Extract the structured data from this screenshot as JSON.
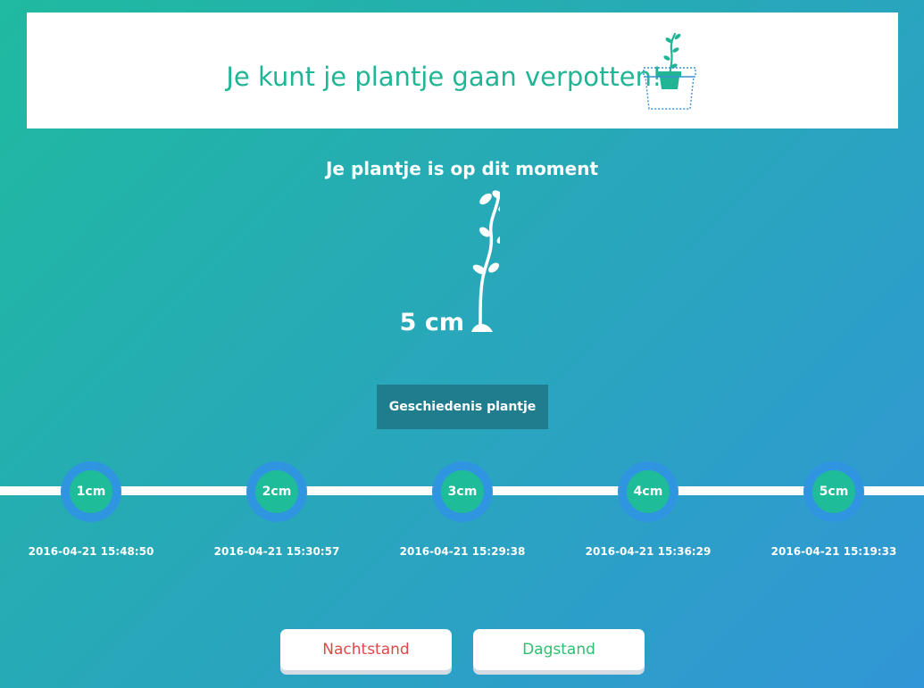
{
  "banner": {
    "message": "Je kunt je plantje gaan verpotten!",
    "icon": "potted-plant-icon",
    "accent_color": "#22b595"
  },
  "current": {
    "heading": "Je plantje is op dit moment",
    "size": "5 cm",
    "icon": "sprout-icon"
  },
  "history_button": {
    "label": "Geschiedenis plantje",
    "color": "#207d8d"
  },
  "timeline": [
    {
      "size": "1cm",
      "date": "2016-04-21 15:48:50"
    },
    {
      "size": "2cm",
      "date": "2016-04-21 15:30:57"
    },
    {
      "size": "3cm",
      "date": "2016-04-21 15:29:38"
    },
    {
      "size": "4cm",
      "date": "2016-04-21 15:36:29"
    },
    {
      "size": "5cm",
      "date": "2016-04-21 15:19:33"
    }
  ],
  "mode_buttons": {
    "night_label": "Nachtstand",
    "day_label": "Dagstand",
    "night_color": "#e04848",
    "day_color": "#2fbe6e"
  },
  "colors": {
    "gradient_start": "#1fba9f",
    "gradient_end": "#3196d6",
    "milestone_ring": "#2f95e0",
    "milestone_fill": "#1fbc99"
  }
}
